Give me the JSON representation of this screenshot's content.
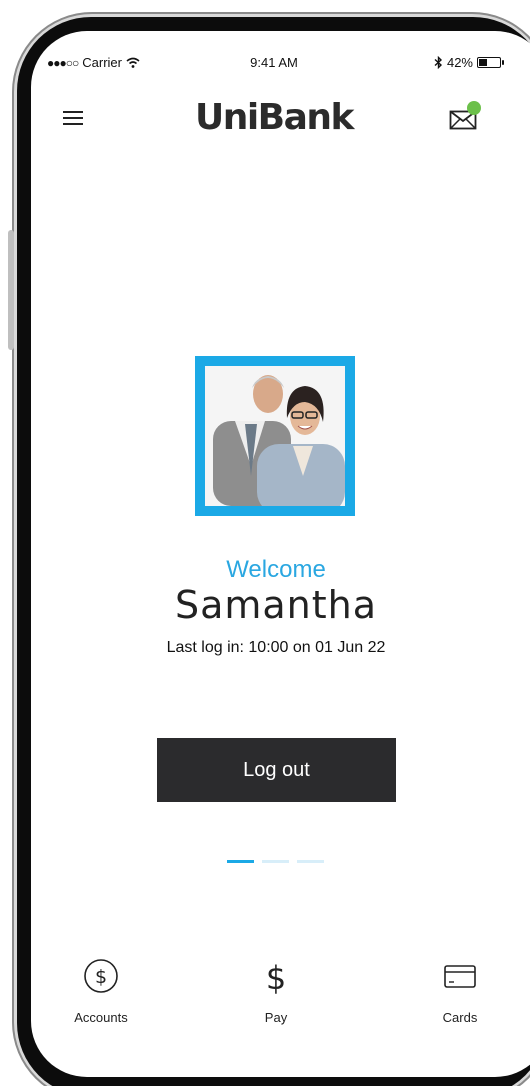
{
  "status_bar": {
    "signal": "●●●○○",
    "carrier": "Carrier",
    "time": "9:41 AM",
    "battery_percent": "42%",
    "battery_level": 0.42,
    "icons": [
      "wifi-icon",
      "bluetooth-icon",
      "battery-icon"
    ]
  },
  "header": {
    "logo": "UniBank",
    "menu_icon": "hamburger-menu-icon",
    "mail_icon": "mail-icon",
    "notification_color": "#6cc04a"
  },
  "profile": {
    "photo_description": "profile-photo",
    "frame_color": "#1ba9e6",
    "welcome": "Welcome",
    "name": "Samantha",
    "last_login": "Last log in: 10:00 on 01 Jun 22"
  },
  "actions": {
    "logout_label": "Log out"
  },
  "pager": {
    "count": 3,
    "active_index": 0
  },
  "bottom_nav": {
    "items": [
      {
        "label": "Accounts",
        "icon": "dollar-circle-icon"
      },
      {
        "label": "Pay",
        "icon": "dollar-sign-icon"
      },
      {
        "label": "Cards",
        "icon": "credit-card-icon"
      }
    ]
  },
  "colors": {
    "accent": "#1ba9e6",
    "button_bg": "#2b2b2d",
    "text_dark": "#222222"
  }
}
